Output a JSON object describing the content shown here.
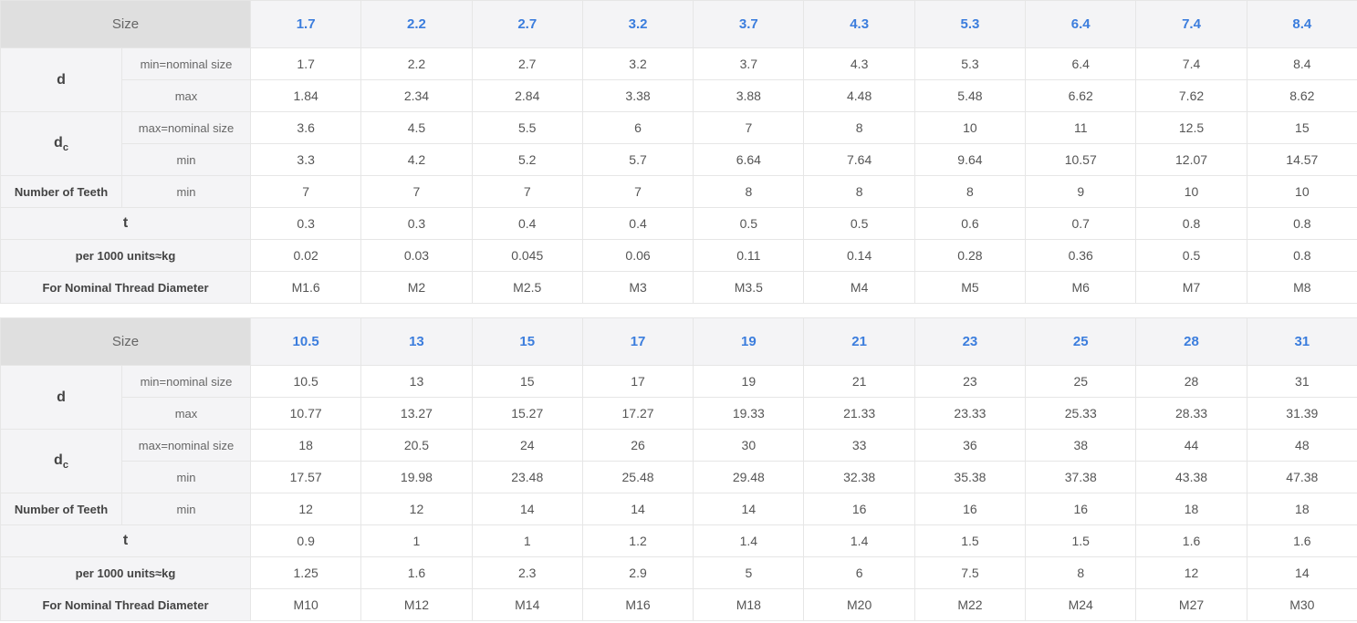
{
  "labels": {
    "size": "Size",
    "d": "d",
    "dc_main": "d",
    "dc_sub": "c",
    "min_nominal": "min=nominal size",
    "max": "max",
    "max_nominal": "max=nominal size",
    "min": "min",
    "teeth": "Number of Teeth",
    "t": "t",
    "weight": "per 1000 units≈kg",
    "thread": "For Nominal Thread Diameter"
  },
  "tables": [
    {
      "sizes": [
        "1.7",
        "2.2",
        "2.7",
        "3.2",
        "3.7",
        "4.3",
        "5.3",
        "6.4",
        "7.4",
        "8.4"
      ],
      "d_min": [
        "1.7",
        "2.2",
        "2.7",
        "3.2",
        "3.7",
        "4.3",
        "5.3",
        "6.4",
        "7.4",
        "8.4"
      ],
      "d_max": [
        "1.84",
        "2.34",
        "2.84",
        "3.38",
        "3.88",
        "4.48",
        "5.48",
        "6.62",
        "7.62",
        "8.62"
      ],
      "dc_max": [
        "3.6",
        "4.5",
        "5.5",
        "6",
        "7",
        "8",
        "10",
        "11",
        "12.5",
        "15"
      ],
      "dc_min": [
        "3.3",
        "4.2",
        "5.2",
        "5.7",
        "6.64",
        "7.64",
        "9.64",
        "10.57",
        "12.07",
        "14.57"
      ],
      "teeth": [
        "7",
        "7",
        "7",
        "7",
        "8",
        "8",
        "8",
        "9",
        "10",
        "10"
      ],
      "t": [
        "0.3",
        "0.3",
        "0.4",
        "0.4",
        "0.5",
        "0.5",
        "0.6",
        "0.7",
        "0.8",
        "0.8"
      ],
      "weight": [
        "0.02",
        "0.03",
        "0.045",
        "0.06",
        "0.11",
        "0.14",
        "0.28",
        "0.36",
        "0.5",
        "0.8"
      ],
      "thread": [
        "M1.6",
        "M2",
        "M2.5",
        "M3",
        "M3.5",
        "M4",
        "M5",
        "M6",
        "M7",
        "M8"
      ]
    },
    {
      "sizes": [
        "10.5",
        "13",
        "15",
        "17",
        "19",
        "21",
        "23",
        "25",
        "28",
        "31"
      ],
      "d_min": [
        "10.5",
        "13",
        "15",
        "17",
        "19",
        "21",
        "23",
        "25",
        "28",
        "31"
      ],
      "d_max": [
        "10.77",
        "13.27",
        "15.27",
        "17.27",
        "19.33",
        "21.33",
        "23.33",
        "25.33",
        "28.33",
        "31.39"
      ],
      "dc_max": [
        "18",
        "20.5",
        "24",
        "26",
        "30",
        "33",
        "36",
        "38",
        "44",
        "48"
      ],
      "dc_min": [
        "17.57",
        "19.98",
        "23.48",
        "25.48",
        "29.48",
        "32.38",
        "35.38",
        "37.38",
        "43.38",
        "47.38"
      ],
      "teeth": [
        "12",
        "12",
        "14",
        "14",
        "14",
        "16",
        "16",
        "16",
        "18",
        "18"
      ],
      "t": [
        "0.9",
        "1",
        "1",
        "1.2",
        "1.4",
        "1.4",
        "1.5",
        "1.5",
        "1.6",
        "1.6"
      ],
      "weight": [
        "1.25",
        "1.6",
        "2.3",
        "2.9",
        "5",
        "6",
        "7.5",
        "8",
        "12",
        "14"
      ],
      "thread": [
        "M10",
        "M12",
        "M14",
        "M16",
        "M18",
        "M20",
        "M22",
        "M24",
        "M27",
        "M30"
      ]
    }
  ]
}
